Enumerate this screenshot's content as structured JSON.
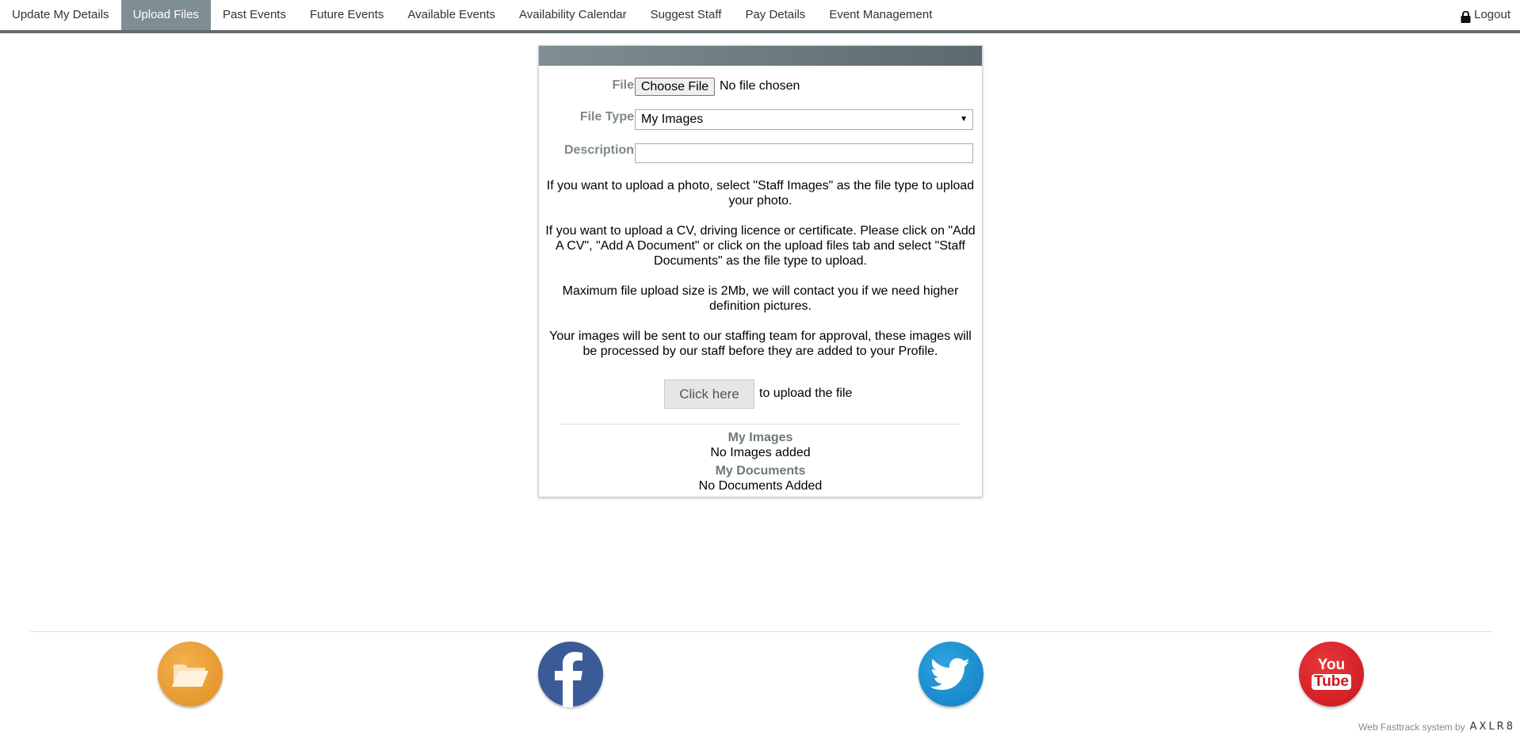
{
  "nav": {
    "items": [
      {
        "label": "Update My Details"
      },
      {
        "label": "Upload Files",
        "active": true
      },
      {
        "label": "Past Events"
      },
      {
        "label": "Future Events"
      },
      {
        "label": "Available Events"
      },
      {
        "label": "Availability Calendar"
      },
      {
        "label": "Suggest Staff"
      },
      {
        "label": "Pay Details"
      },
      {
        "label": "Event Management"
      }
    ],
    "logout_label": "Logout",
    "logout_icon": "lock-icon",
    "accent_color": "#7f8e92"
  },
  "form": {
    "file_label": "File",
    "file_button": "Choose File",
    "file_status": "No file chosen",
    "file_type_label": "File Type",
    "file_type_value": "My Images",
    "description_label": "Description",
    "description_value": ""
  },
  "info": {
    "photo": "If you want to upload a photo, select \"Staff Images\" as the file type to upload your photo.",
    "cv": "If you want to upload a CV, driving licence or certificate. Please click on \"Add A CV\", \"Add A Document\" or click on the upload files tab and select \"Staff Documents\" as the file type to upload.",
    "size": "Maximum file upload size is 2Mb, we will contact you if we need higher definition pictures.",
    "approval": "Your images will be sent to our staffing team for approval, these images will be processed by our staff before they are added to your Profile."
  },
  "upload": {
    "button": "Click here",
    "text": "to upload the file"
  },
  "sections": {
    "images_title": "My Images",
    "images_value": "No Images added",
    "documents_title": "My Documents",
    "documents_value": "No Documents Added"
  },
  "footer": {
    "icons": [
      "folder-icon",
      "facebook-icon",
      "twitter-icon",
      "youtube-icon"
    ],
    "youtube_text_1": "You",
    "youtube_text_2": "Tube",
    "credit": "Web Fasttrack system by",
    "brand": "AXLR8"
  }
}
